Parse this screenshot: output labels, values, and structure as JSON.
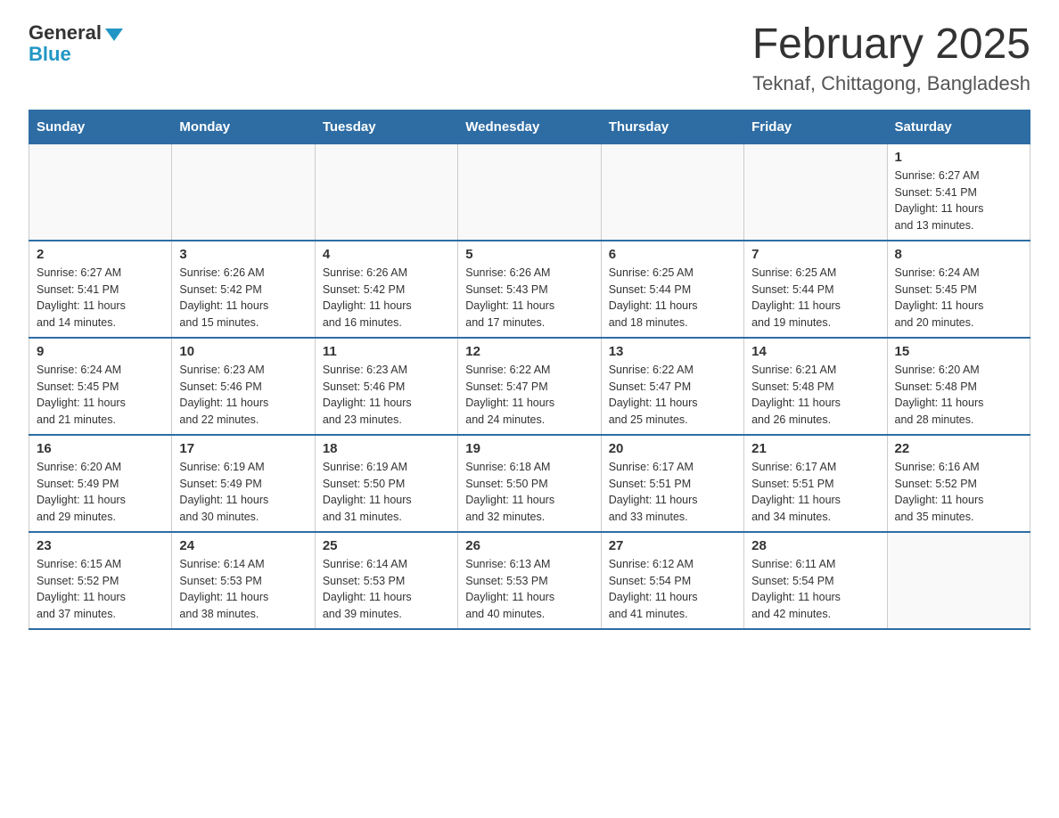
{
  "logo": {
    "general": "General",
    "blue": "Blue"
  },
  "title": "February 2025",
  "location": "Teknaf, Chittagong, Bangladesh",
  "weekdays": [
    "Sunday",
    "Monday",
    "Tuesday",
    "Wednesday",
    "Thursday",
    "Friday",
    "Saturday"
  ],
  "weeks": [
    [
      {
        "day": "",
        "info": ""
      },
      {
        "day": "",
        "info": ""
      },
      {
        "day": "",
        "info": ""
      },
      {
        "day": "",
        "info": ""
      },
      {
        "day": "",
        "info": ""
      },
      {
        "day": "",
        "info": ""
      },
      {
        "day": "1",
        "info": "Sunrise: 6:27 AM\nSunset: 5:41 PM\nDaylight: 11 hours\nand 13 minutes."
      }
    ],
    [
      {
        "day": "2",
        "info": "Sunrise: 6:27 AM\nSunset: 5:41 PM\nDaylight: 11 hours\nand 14 minutes."
      },
      {
        "day": "3",
        "info": "Sunrise: 6:26 AM\nSunset: 5:42 PM\nDaylight: 11 hours\nand 15 minutes."
      },
      {
        "day": "4",
        "info": "Sunrise: 6:26 AM\nSunset: 5:42 PM\nDaylight: 11 hours\nand 16 minutes."
      },
      {
        "day": "5",
        "info": "Sunrise: 6:26 AM\nSunset: 5:43 PM\nDaylight: 11 hours\nand 17 minutes."
      },
      {
        "day": "6",
        "info": "Sunrise: 6:25 AM\nSunset: 5:44 PM\nDaylight: 11 hours\nand 18 minutes."
      },
      {
        "day": "7",
        "info": "Sunrise: 6:25 AM\nSunset: 5:44 PM\nDaylight: 11 hours\nand 19 minutes."
      },
      {
        "day": "8",
        "info": "Sunrise: 6:24 AM\nSunset: 5:45 PM\nDaylight: 11 hours\nand 20 minutes."
      }
    ],
    [
      {
        "day": "9",
        "info": "Sunrise: 6:24 AM\nSunset: 5:45 PM\nDaylight: 11 hours\nand 21 minutes."
      },
      {
        "day": "10",
        "info": "Sunrise: 6:23 AM\nSunset: 5:46 PM\nDaylight: 11 hours\nand 22 minutes."
      },
      {
        "day": "11",
        "info": "Sunrise: 6:23 AM\nSunset: 5:46 PM\nDaylight: 11 hours\nand 23 minutes."
      },
      {
        "day": "12",
        "info": "Sunrise: 6:22 AM\nSunset: 5:47 PM\nDaylight: 11 hours\nand 24 minutes."
      },
      {
        "day": "13",
        "info": "Sunrise: 6:22 AM\nSunset: 5:47 PM\nDaylight: 11 hours\nand 25 minutes."
      },
      {
        "day": "14",
        "info": "Sunrise: 6:21 AM\nSunset: 5:48 PM\nDaylight: 11 hours\nand 26 minutes."
      },
      {
        "day": "15",
        "info": "Sunrise: 6:20 AM\nSunset: 5:48 PM\nDaylight: 11 hours\nand 28 minutes."
      }
    ],
    [
      {
        "day": "16",
        "info": "Sunrise: 6:20 AM\nSunset: 5:49 PM\nDaylight: 11 hours\nand 29 minutes."
      },
      {
        "day": "17",
        "info": "Sunrise: 6:19 AM\nSunset: 5:49 PM\nDaylight: 11 hours\nand 30 minutes."
      },
      {
        "day": "18",
        "info": "Sunrise: 6:19 AM\nSunset: 5:50 PM\nDaylight: 11 hours\nand 31 minutes."
      },
      {
        "day": "19",
        "info": "Sunrise: 6:18 AM\nSunset: 5:50 PM\nDaylight: 11 hours\nand 32 minutes."
      },
      {
        "day": "20",
        "info": "Sunrise: 6:17 AM\nSunset: 5:51 PM\nDaylight: 11 hours\nand 33 minutes."
      },
      {
        "day": "21",
        "info": "Sunrise: 6:17 AM\nSunset: 5:51 PM\nDaylight: 11 hours\nand 34 minutes."
      },
      {
        "day": "22",
        "info": "Sunrise: 6:16 AM\nSunset: 5:52 PM\nDaylight: 11 hours\nand 35 minutes."
      }
    ],
    [
      {
        "day": "23",
        "info": "Sunrise: 6:15 AM\nSunset: 5:52 PM\nDaylight: 11 hours\nand 37 minutes."
      },
      {
        "day": "24",
        "info": "Sunrise: 6:14 AM\nSunset: 5:53 PM\nDaylight: 11 hours\nand 38 minutes."
      },
      {
        "day": "25",
        "info": "Sunrise: 6:14 AM\nSunset: 5:53 PM\nDaylight: 11 hours\nand 39 minutes."
      },
      {
        "day": "26",
        "info": "Sunrise: 6:13 AM\nSunset: 5:53 PM\nDaylight: 11 hours\nand 40 minutes."
      },
      {
        "day": "27",
        "info": "Sunrise: 6:12 AM\nSunset: 5:54 PM\nDaylight: 11 hours\nand 41 minutes."
      },
      {
        "day": "28",
        "info": "Sunrise: 6:11 AM\nSunset: 5:54 PM\nDaylight: 11 hours\nand 42 minutes."
      },
      {
        "day": "",
        "info": ""
      }
    ]
  ]
}
